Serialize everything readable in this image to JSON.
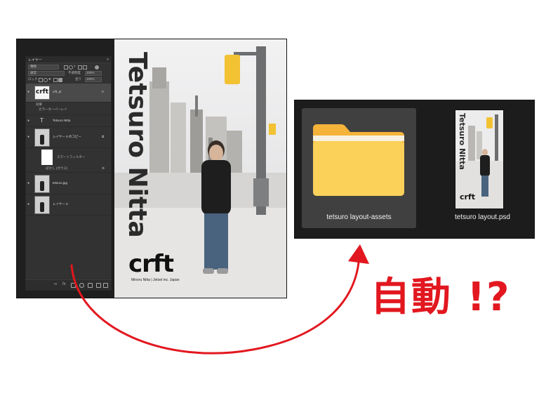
{
  "photoshop": {
    "panel_title": "レイヤー",
    "filter_label": "種類",
    "blend_mode": "通常",
    "opacity_label": "不透明度",
    "opacity_value": "100%",
    "lock_label": "ロック",
    "fill_label": "塗り",
    "fill_value": "100%",
    "layers": [
      {
        "name": "crft_ai",
        "type": "smart-object",
        "selected": true
      },
      {
        "name": "Tetsuro Nitta",
        "type": "text"
      },
      {
        "name": "レイヤー 0 のコピー",
        "type": "raster"
      },
      {
        "name": "tetsuro.jpg",
        "type": "raster"
      },
      {
        "name": "レイヤー 0",
        "type": "raster"
      }
    ],
    "effects_label": "効果",
    "color_overlay_label": "カラーオーバーレイ",
    "smart_filter_label": "スマートフィルター",
    "blur_label": "ぼかし (ガウス)"
  },
  "poster": {
    "title": "Tetsuro Nitta",
    "logo": "crft",
    "credit": "Minoru Nitta | Jetset inc. Japan"
  },
  "explorer": {
    "items": [
      {
        "label": "tetsuro layout-assets",
        "kind": "folder"
      },
      {
        "label": "tetsuro layout.psd",
        "kind": "psd"
      }
    ]
  },
  "annotation": {
    "text": "自動 !?",
    "color": "#e2171f"
  },
  "colors": {
    "folder_front": "#fcd15a",
    "folder_back": "#f5b33a",
    "explorer_bg": "#1c1c1c",
    "selected_tile": "#404040",
    "ps_bg": "#1f1f1f"
  }
}
